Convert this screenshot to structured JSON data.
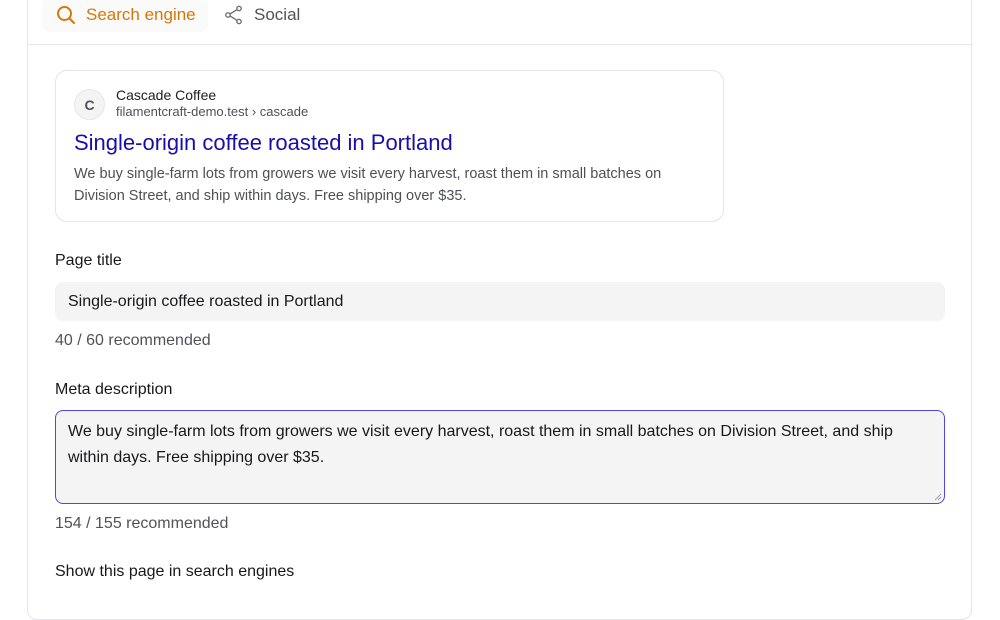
{
  "tabs": [
    {
      "label": "Search engine",
      "icon": "search-icon",
      "active": true,
      "color": "#d97706"
    },
    {
      "label": "Social",
      "icon": "share-icon",
      "active": false
    }
  ],
  "preview": {
    "favicon_letter": "C",
    "site_name": "Cascade Coffee",
    "url": "filamentcraft-demo.test › cascade",
    "title": "Single-origin coffee roasted in Portland",
    "description": "We buy single-farm lots from growers we visit every harvest, roast them in small batches on Division Street, and ship within days. Free shipping over $35.",
    "title_color": "#1a0dab"
  },
  "fields": {
    "page_title": {
      "label": "Page title",
      "value": "Single-origin coffee roasted in Portland",
      "counter": "40 / 60 recommended"
    },
    "meta_description": {
      "label": "Meta description",
      "value": "We buy single-farm lots from growers we visit every harvest, roast them in small batches on Division Street, and ship within days. Free shipping over $35.",
      "counter": "154 / 155 recommended",
      "focus_color": "#4f46e5"
    },
    "visibility": {
      "label": "Show this page in search engines"
    }
  }
}
